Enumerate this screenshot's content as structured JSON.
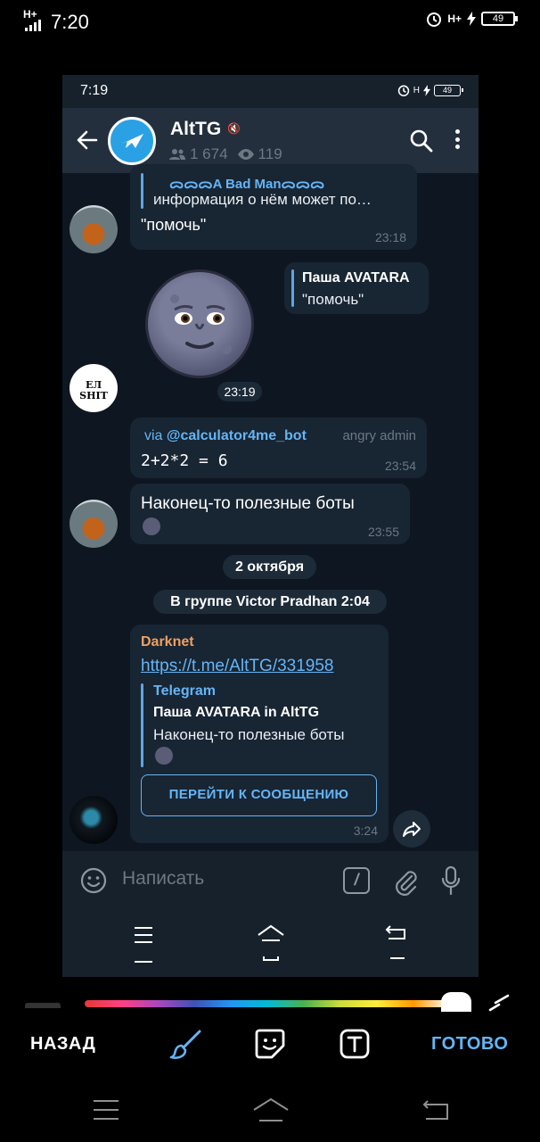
{
  "outer_status": {
    "signal": "H+",
    "time": "7:20",
    "network": "H+",
    "battery": "49"
  },
  "inner_status": {
    "signal": "H",
    "time": "7:19",
    "network": "H",
    "battery": "49"
  },
  "header": {
    "title": "AltTG",
    "subscribers": "1 674",
    "online": "119"
  },
  "messages": {
    "m1": {
      "reply_name": "ᯅᯅᯅA Bad Manᯅᯅᯅ",
      "reply_text": "информация о нём может по…",
      "text": "\"помочь\"",
      "time": "23:18"
    },
    "m2": {
      "reply_name": "Паша AVATARA",
      "reply_text": "\"помочь\""
    },
    "sticker": {
      "time": "23:19"
    },
    "m3": {
      "via_prefix": "via",
      "via_bot": "@calculator4me_bot",
      "role": "angry admin",
      "text": "2+2*2 = 6",
      "time": "23:54"
    },
    "m4": {
      "text": "Наконец-то полезные боты",
      "time": "23:55"
    },
    "date_divider": "2 октября",
    "group_divider": "В группе Victor Pradhan  2:04",
    "m5": {
      "author": "Darknet",
      "link": "https://t.me/AltTG/331958",
      "quote_source": "Telegram",
      "quote_name": "Паша AVATARA in AltTG",
      "quote_text": "Наконец-то полезные боты",
      "button": "ПЕРЕЙТИ К СООБЩЕНИЮ",
      "time": "3:24"
    }
  },
  "avatars": {
    "shit_top": "ЕЛ",
    "shit_bottom": "SHIT"
  },
  "composer": {
    "placeholder": "Написать"
  },
  "editor": {
    "back_label": "НАЗАД",
    "done_label": "ГОТОВО"
  }
}
